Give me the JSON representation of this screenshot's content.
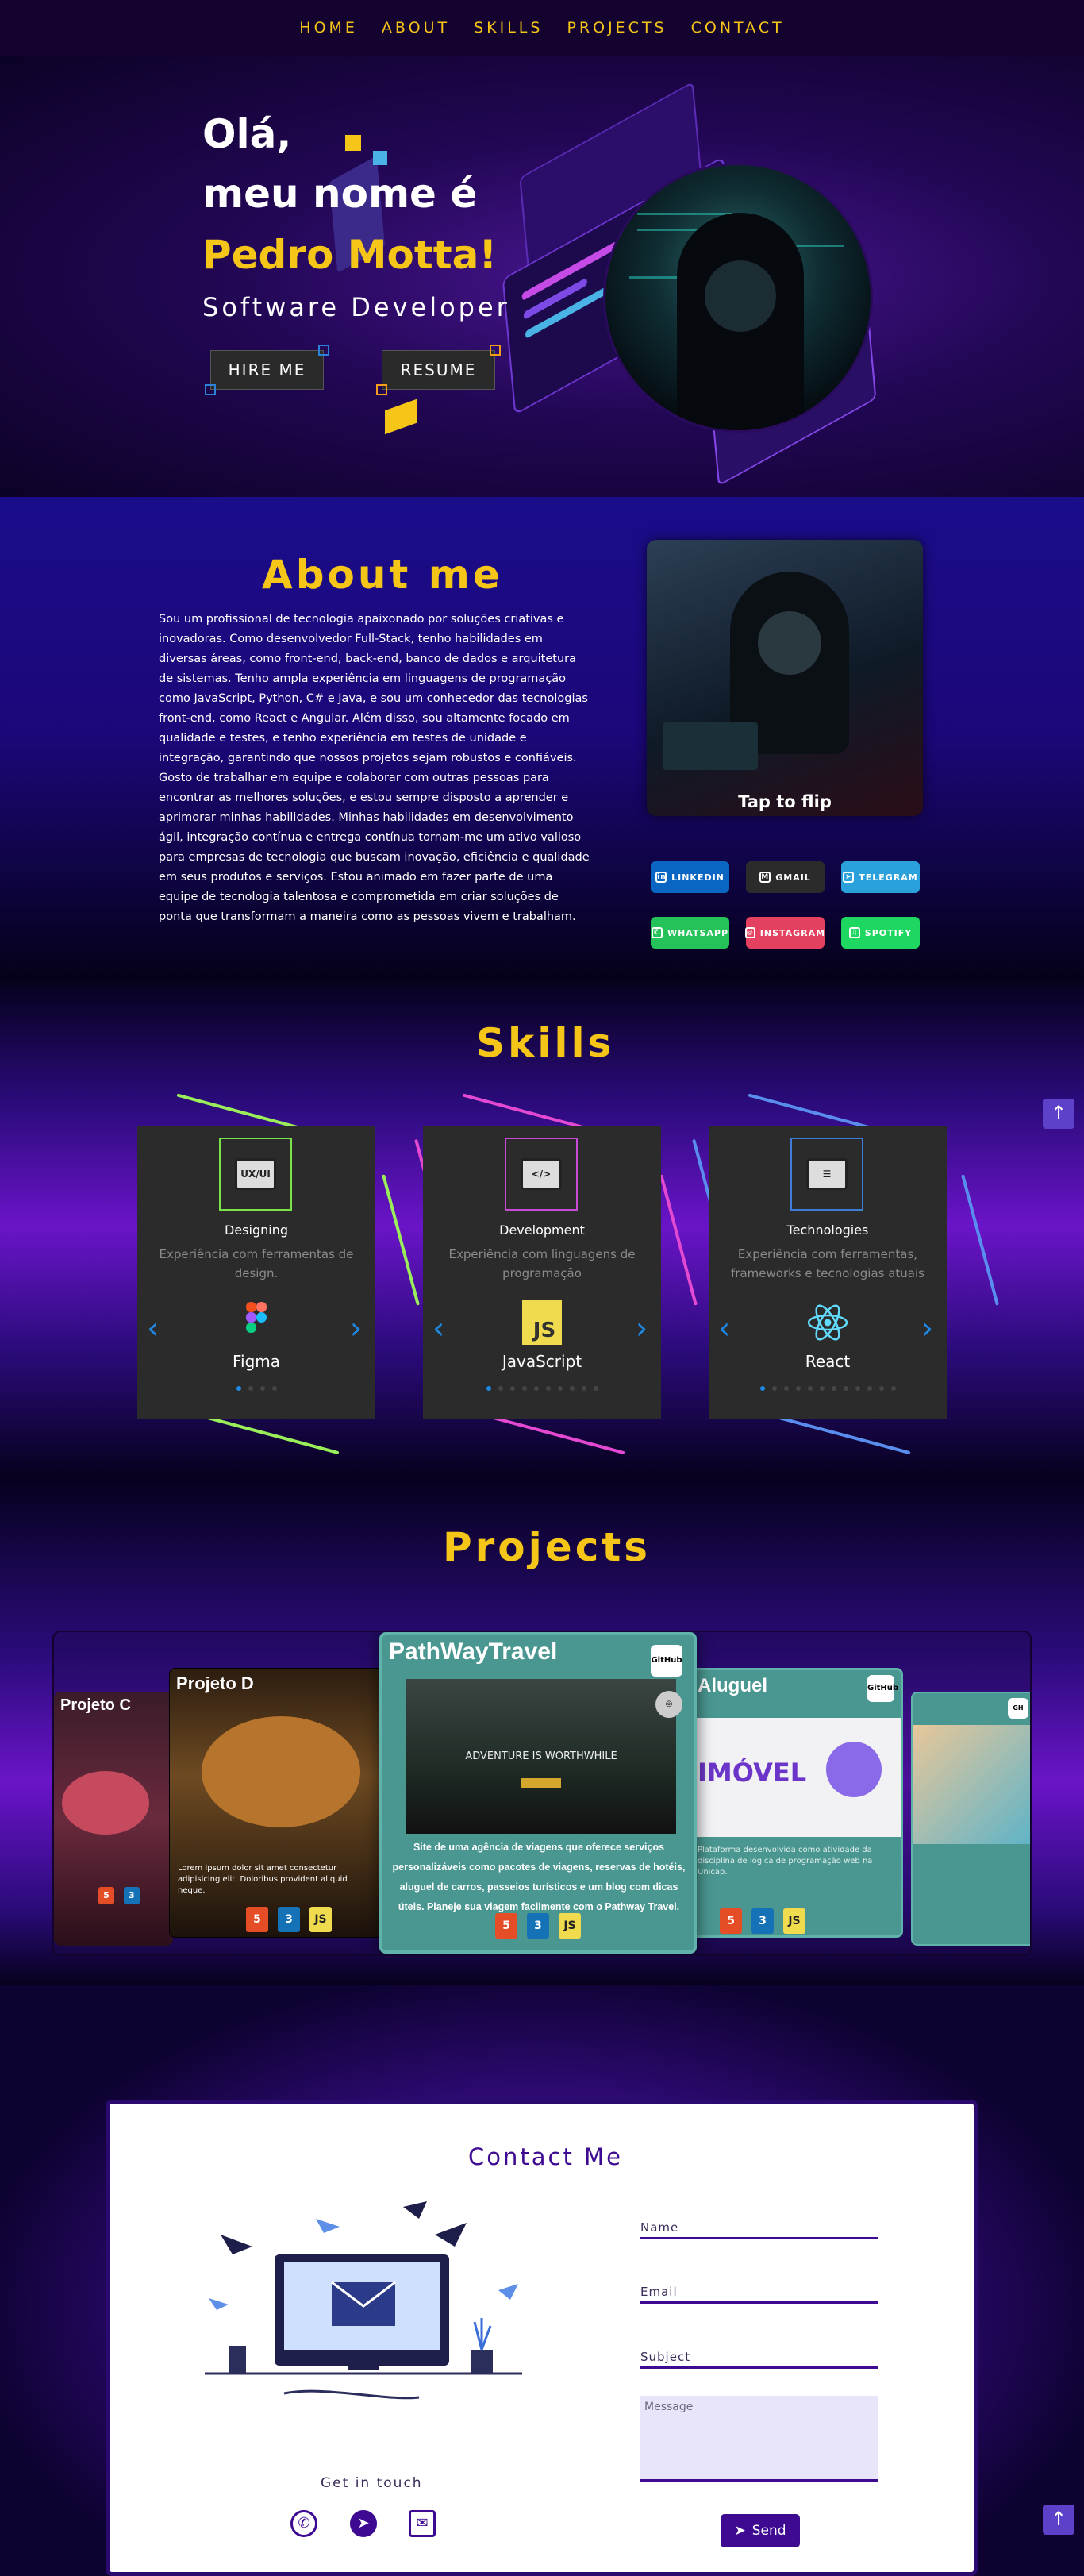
{
  "nav": {
    "items": [
      "HOME",
      "ABOUT",
      "SKILLS",
      "PROJECTS",
      "CONTACT"
    ]
  },
  "hero": {
    "greeting": "Olá,",
    "line1": "meu nome é",
    "name": "Pedro Motta!",
    "role": "Software Developer",
    "hire_label": "HIRE ME",
    "resume_label": "RESUME"
  },
  "about": {
    "title": "About me",
    "text": "Sou um profissional de tecnologia apaixonado por soluções criativas e inovadoras. Como desenvolvedor Full-Stack, tenho habilidades em diversas áreas, como front-end, back-end, banco de dados e arquitetura de sistemas. Tenho ampla experiência em linguagens de programação como JavaScript, Python, C# e Java, e sou um conhecedor das tecnologias front-end, como React e Angular. Além disso, sou altamente focado em qualidade e testes, e tenho experiência em testes de unidade e integração, garantindo que nossos projetos sejam robustos e confiáveis. Gosto de trabalhar em equipe e colaborar com outras pessoas para encontrar as melhores soluções, e estou sempre disposto a aprender e aprimorar minhas habilidades. Minhas habilidades em desenvolvimento ágil, integração contínua e entrega contínua tornam-me um ativo valioso para empresas de tecnologia que buscam inovação, eficiência e qualidade em seus produtos e serviços. Estou animado em fazer parte de uma equipe de tecnologia talentosa e comprometida em criar soluções de ponta que transformam a maneira como as pessoas vivem e trabalham.",
    "flip_label": "Tap to flip",
    "socials": [
      {
        "label": "LINKEDIN",
        "color": "#0a66c2",
        "icon": "in"
      },
      {
        "label": "GMAIL",
        "color": "#2b2b2b",
        "icon": "M"
      },
      {
        "label": "TELEGRAM",
        "color": "#2aa1da",
        "icon": "➤"
      },
      {
        "label": "WHATSAPP",
        "color": "#25c25a",
        "icon": "✆"
      },
      {
        "label": "INSTAGRAM",
        "color": "#e4405f",
        "icon": "◎"
      },
      {
        "label": "SPOTIFY",
        "color": "#1ed760",
        "icon": "♫"
      }
    ]
  },
  "skills": {
    "title": "Skills",
    "cards": [
      {
        "icon_text": "UX/UI",
        "border": "#7be34a",
        "name": "Designing",
        "desc": "Experiência com ferramentas de design.",
        "tech": "Figma",
        "dots": 4,
        "active": 0
      },
      {
        "icon_text": "</>",
        "border": "#c74ad6",
        "name": "Development",
        "desc": "Experiência com linguagens de programação",
        "tech": "JavaScript",
        "dots": 10,
        "active": 0
      },
      {
        "icon_text": "☰",
        "border": "#3d7dd6",
        "name": "Technologies",
        "desc": "Experiência com ferramentas, frameworks e tecnologias atuais",
        "tech": "React",
        "dots": 12,
        "active": 0
      }
    ]
  },
  "projects": {
    "title": "Projects",
    "items": [
      {
        "name": "Projeto C"
      },
      {
        "name": "Projeto D",
        "desc": "Lorem ipsum dolor sit amet consectetur adipisicing elit. Doloribus provident aliquid neque."
      },
      {
        "name": "PathWayTravel",
        "hero_text": "ADVENTURE IS WORTHWHILE",
        "desc": "Site de uma agência de viagens que oferece serviços personalizáveis como pacotes de viagens, reservas de hotéis, aluguel de carros, passeios turísticos e um blog com dicas úteis. Planeje sua viagem facilmente com o Pathway Travel."
      },
      {
        "name": "Aluguel",
        "hero_text": "IMÓVEL",
        "desc": "Plataforma desenvolvida como atividade da disciplina de lógica de programação web na Unicap."
      },
      {
        "name": ""
      }
    ],
    "github_label": "GitHub"
  },
  "contact": {
    "title": "Contact Me",
    "get_in_touch": "Get in touch",
    "name_label": "Name",
    "email_label": "Email",
    "subject_label": "Subject",
    "message_placeholder": "Message",
    "send_label": "Send"
  }
}
